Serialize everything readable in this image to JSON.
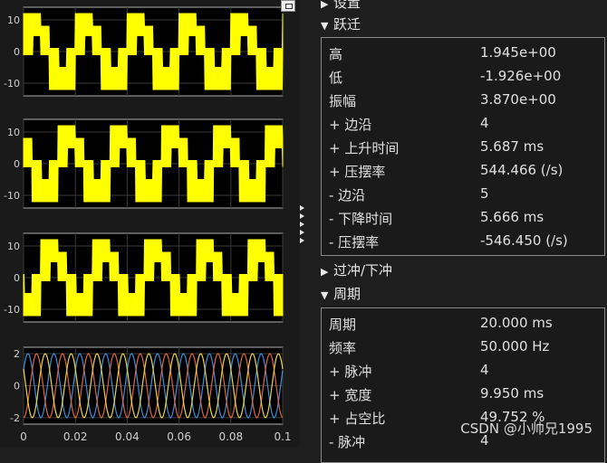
{
  "scope": {
    "axes": [
      {
        "yticks": [
          "10",
          "0",
          "-10"
        ]
      },
      {
        "yticks": [
          "10",
          "0",
          "-10"
        ]
      },
      {
        "yticks": [
          "10",
          "0",
          "-10"
        ]
      },
      {
        "yticks": [
          "2",
          "0",
          "-2"
        ]
      }
    ],
    "xticks": [
      "0",
      "0.02",
      "0.04",
      "0.06",
      "0.08",
      "0.1"
    ],
    "trace_color": "#ffff00",
    "sine_colors": [
      "#3c8fde",
      "#e0663c",
      "#e8d54a"
    ]
  },
  "panel": {
    "settings_header": "设置",
    "transitions": {
      "header": "跃迁",
      "rows": [
        {
          "label": "高",
          "value": "1.945e+00"
        },
        {
          "label": "低",
          "value": "-1.926e+00"
        },
        {
          "label": "振幅",
          "value": "3.870e+00"
        },
        {
          "label": "+ 边沿",
          "value": "4"
        },
        {
          "label": "+ 上升时间",
          "value": "5.687 ms"
        },
        {
          "label": "+ 压摆率",
          "value": "544.466 (/s)"
        },
        {
          "label": "- 边沿",
          "value": "5"
        },
        {
          "label": "- 下降时间",
          "value": "5.666 ms"
        },
        {
          "label": "- 压摆率",
          "value": "-546.450 (/s)"
        }
      ]
    },
    "overshoot_header": "过冲/下冲",
    "cycles": {
      "header": "周期",
      "rows": [
        {
          "label": "周期",
          "value": "20.000 ms"
        },
        {
          "label": "频率",
          "value": "50.000 Hz"
        },
        {
          "label": "+ 脉冲",
          "value": "4"
        },
        {
          "label": "+ 宽度",
          "value": "9.950 ms"
        },
        {
          "label": "+ 占空比",
          "value": "49.752 %"
        },
        {
          "label": "- 脉冲",
          "value": "4"
        }
      ]
    }
  },
  "watermark": "CSDN @小帅兄1995"
}
